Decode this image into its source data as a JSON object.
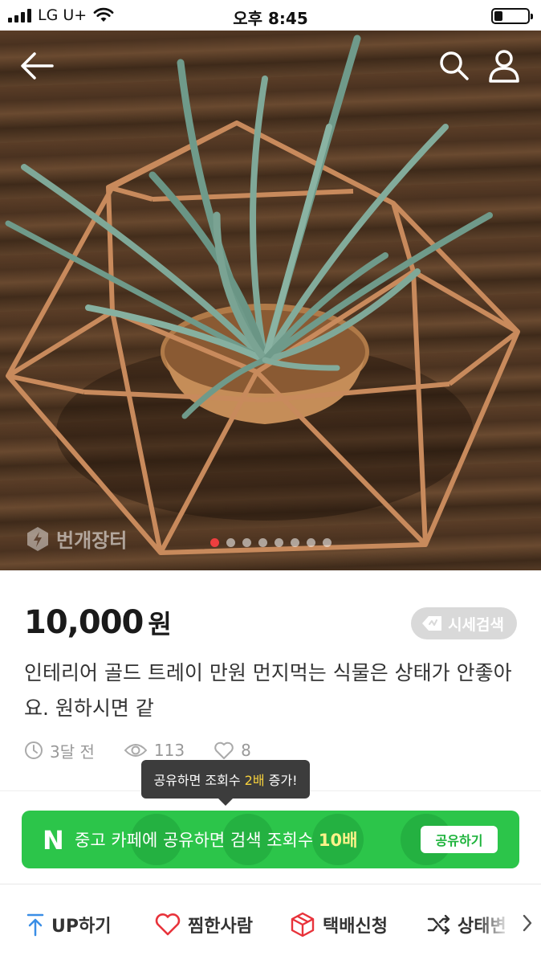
{
  "status_bar": {
    "carrier": "LG U+",
    "time": "오후 8:45",
    "battery_level": 0.25
  },
  "top_bar": {
    "back_icon": "arrow-left-icon",
    "search_icon": "search-icon",
    "profile_icon": "user-icon"
  },
  "photo": {
    "watermark": "번개장터",
    "dots_total": 8,
    "dots_active": 1
  },
  "product": {
    "price": "10,000",
    "currency": "원",
    "market_button": "시세검색",
    "title": "인테리어 골드 트레이 만원 먼지먹는 식물은 상태가 안좋아요. 원하시면 같",
    "posted": "3달 전",
    "views": "113",
    "likes": "8"
  },
  "tooltip": {
    "before": "공유하면 조회수 ",
    "highlight": "2배",
    "after": " 증가!"
  },
  "share_banner": {
    "logo": "N",
    "text_before": "중고 카페에 공유하면 검색 조회수 ",
    "text_highlight": "10배",
    "button": "공유하기",
    "color": "#2cc54a"
  },
  "actions": [
    {
      "label": "UP하기",
      "icon": "up-arrow-icon",
      "color": "#3a8ee6"
    },
    {
      "label": "찜한사람",
      "icon": "heart-icon",
      "color": "#e8333b"
    },
    {
      "label": "택배신청",
      "icon": "box-icon",
      "color": "#e8333b"
    },
    {
      "label": "상태변",
      "icon": "shuffle-icon",
      "color": "#333333"
    }
  ],
  "colors": {
    "accent_red": "#ee3f3f",
    "text_dark": "#1a1a1a",
    "meta_gray": "#999999",
    "highlight_yellow": "#f7d13c"
  }
}
